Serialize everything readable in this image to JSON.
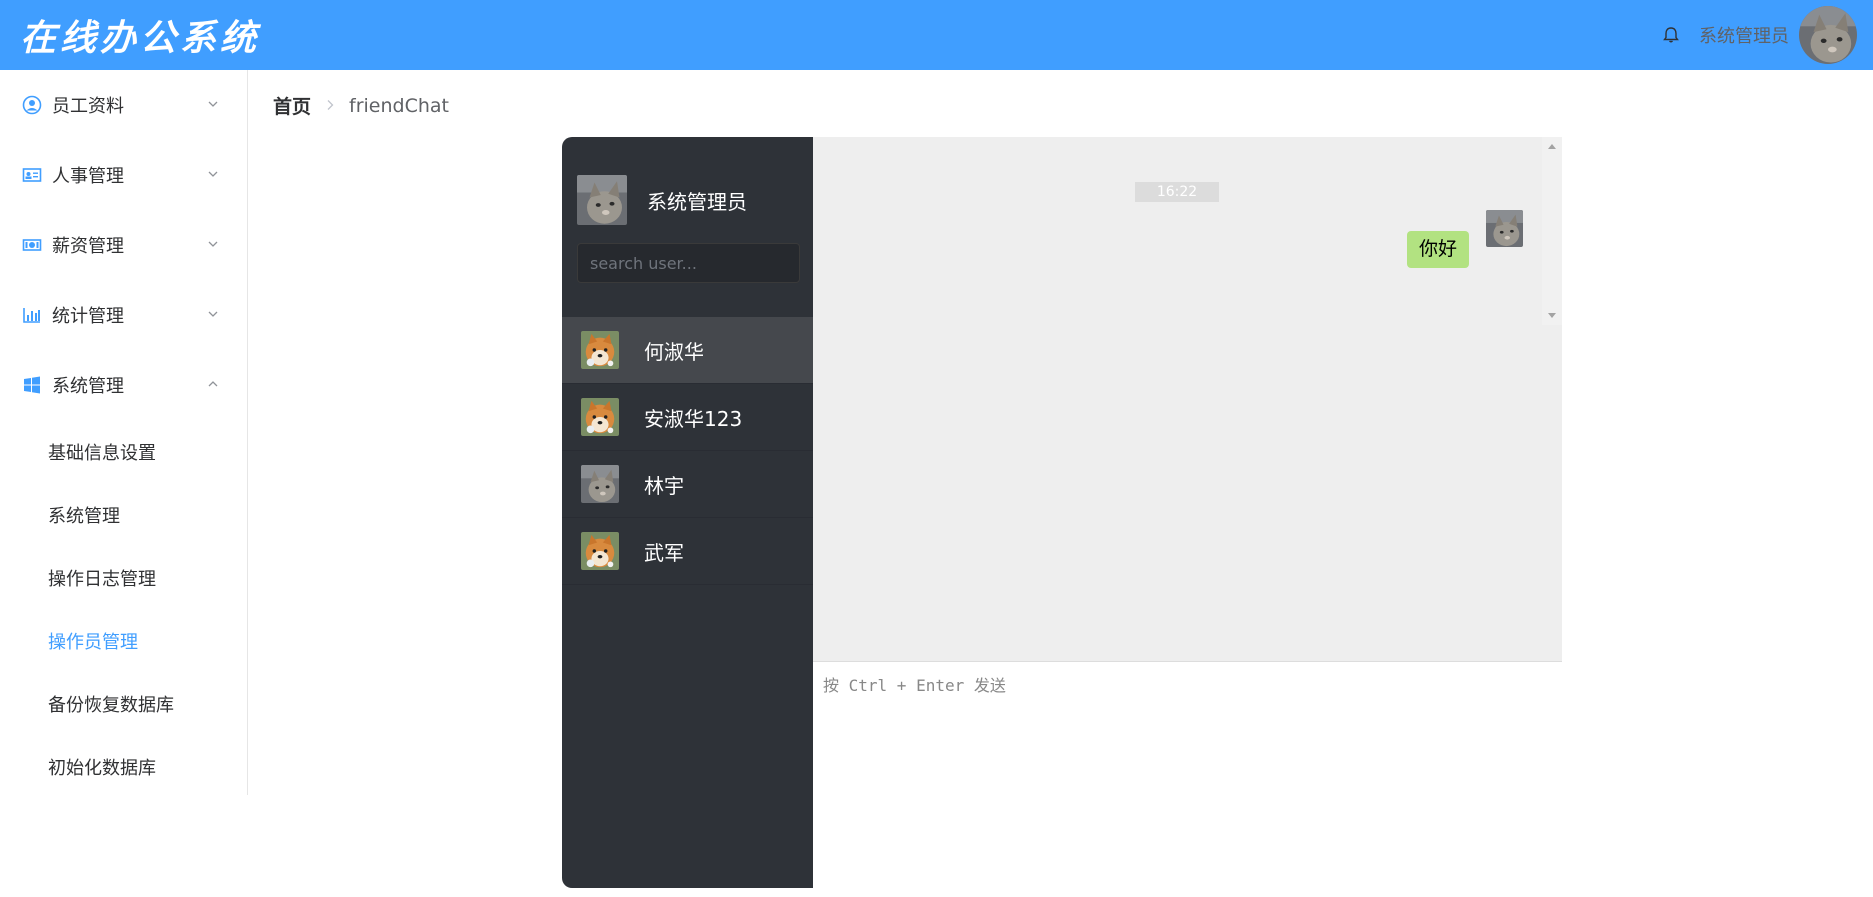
{
  "header": {
    "app_title": "在线办公系统",
    "user_name": "系统管理员",
    "bell_icon": "bell-icon"
  },
  "sidebar": {
    "menus": [
      {
        "label": "员工资料",
        "icon": "user-circle-icon",
        "expanded": false
      },
      {
        "label": "人事管理",
        "icon": "id-card-icon",
        "expanded": false
      },
      {
        "label": "薪资管理",
        "icon": "money-icon",
        "expanded": false
      },
      {
        "label": "统计管理",
        "icon": "bar-chart-icon",
        "expanded": false
      },
      {
        "label": "系统管理",
        "icon": "windows-icon",
        "expanded": true
      }
    ],
    "submenu": [
      {
        "label": "基础信息设置",
        "active": false
      },
      {
        "label": "系统管理",
        "active": false
      },
      {
        "label": "操作日志管理",
        "active": false
      },
      {
        "label": "操作员管理",
        "active": true
      },
      {
        "label": "备份恢复数据库",
        "active": false
      },
      {
        "label": "初始化数据库",
        "active": false
      }
    ]
  },
  "breadcrumb": {
    "home": "首页",
    "current": "friendChat"
  },
  "chat": {
    "me": {
      "name": "系统管理员"
    },
    "search": {
      "placeholder": "search user..."
    },
    "users": [
      {
        "name": "何淑华",
        "avatar": "dog",
        "active": true
      },
      {
        "name": "安淑华123",
        "avatar": "dog",
        "active": false
      },
      {
        "name": "林宇",
        "avatar": "cat",
        "active": false
      },
      {
        "name": "武军",
        "avatar": "dog",
        "active": false
      }
    ],
    "messages": [
      {
        "time": "16:22",
        "text": "你好",
        "self": true
      }
    ],
    "input": {
      "placeholder": "按 Ctrl + Enter 发送"
    }
  },
  "colors": {
    "primary": "#409eff",
    "chat_sidebar": "#2e3238",
    "bubble_self": "#b2e281"
  }
}
